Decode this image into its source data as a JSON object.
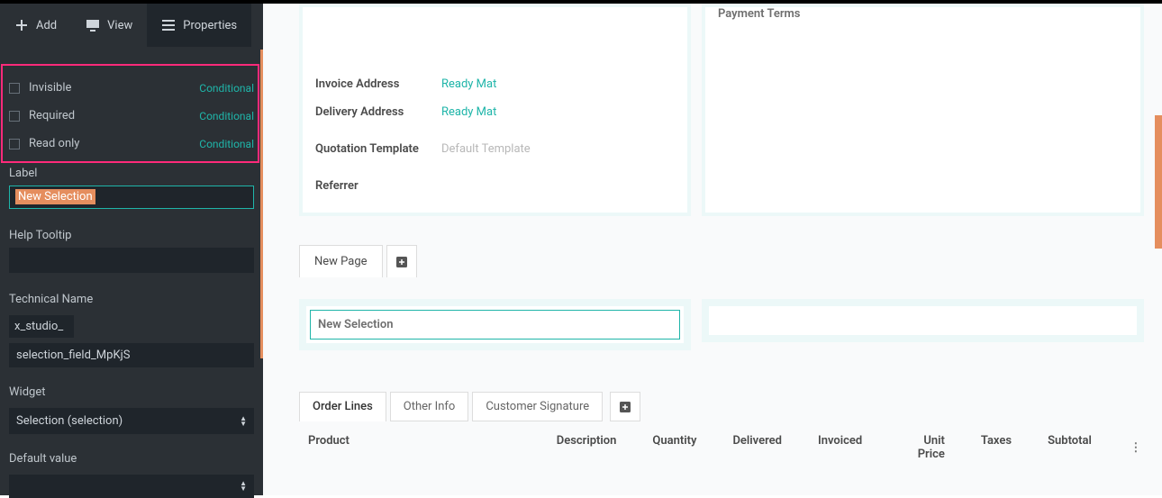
{
  "sidebar": {
    "tabs": {
      "add": "Add",
      "view": "View",
      "properties": "Properties"
    },
    "checks": {
      "invisible": {
        "label": "Invisible",
        "action": "Conditional"
      },
      "required": {
        "label": "Required",
        "action": "Conditional"
      },
      "readonly": {
        "label": "Read only",
        "action": "Conditional"
      }
    },
    "label": {
      "title": "Label",
      "value": "New Selection"
    },
    "helpTooltip": {
      "title": "Help Tooltip",
      "value": ""
    },
    "technical": {
      "title": "Technical Name",
      "prefix": "x_studio_",
      "value": "selection_field_MpKjS"
    },
    "widget": {
      "title": "Widget",
      "value": "Selection (selection)"
    },
    "default": {
      "title": "Default value",
      "value": ""
    }
  },
  "form": {
    "paymentTerms": "Payment Terms",
    "invoiceAddress": {
      "label": "Invoice Address",
      "value": "Ready Mat"
    },
    "deliveryAddress": {
      "label": "Delivery Address",
      "value": "Ready Mat"
    },
    "quotationTemplate": {
      "label": "Quotation Template",
      "value": "Default Template"
    },
    "referrer": {
      "label": "Referrer",
      "value": ""
    }
  },
  "newPageTab": "New Page",
  "newSelection": "New Selection",
  "detailTabs": {
    "orderLines": "Order Lines",
    "otherInfo": "Other Info",
    "customerSignature": "Customer Signature"
  },
  "columns": {
    "product": "Product",
    "description": "Description",
    "quantity": "Quantity",
    "delivered": "Delivered",
    "invoiced": "Invoiced",
    "unitPrice": "Unit Price",
    "taxes": "Taxes",
    "subtotal": "Subtotal"
  }
}
